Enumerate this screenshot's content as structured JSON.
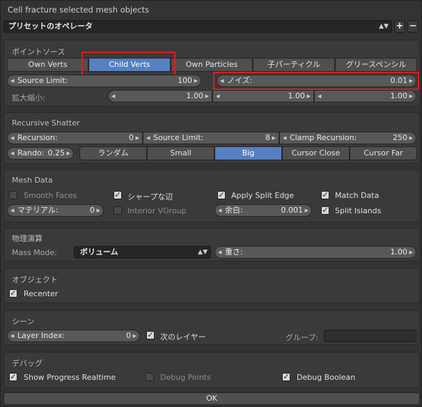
{
  "window": {
    "title": "Cell fracture selected mesh objects"
  },
  "preset": {
    "label": "プリセットのオペレータ",
    "add": "+",
    "remove": "−"
  },
  "point_source": {
    "title": "ポイントソース",
    "modes": [
      "Own Verts",
      "Child Verts",
      "Own Particles",
      "子パーティクル",
      "グリースペンシル"
    ],
    "selected": "Child Verts",
    "source_limit": {
      "label": "Source Limit:",
      "value": "100"
    },
    "noise": {
      "label": "ノイズ:",
      "value": "0.01"
    },
    "scale": {
      "label": "拡大縮小:",
      "x": "1.00",
      "y": "1.00",
      "z": "1.00"
    }
  },
  "recursive": {
    "title": "Recursive Shatter",
    "recursion": {
      "label": "Recursion:",
      "value": "0"
    },
    "source_limit": {
      "label": "Source Limit:",
      "value": "8"
    },
    "clamp": {
      "label": "Clamp Recursion:",
      "value": "250"
    },
    "rando": {
      "label": "Rando:",
      "value": "0.25"
    },
    "modes": [
      "ランダム",
      "Small",
      "Big",
      "Cursor Close",
      "Cursor Far"
    ],
    "selected": "Big"
  },
  "mesh": {
    "title": "Mesh Data",
    "smooth_faces": "Smooth Faces",
    "sharp_edges": "シャープな辺",
    "apply_split_edge": "Apply Split Edge",
    "match_data": "Match Data",
    "material": {
      "label": "マテリアル:",
      "value": "0"
    },
    "interior_vgroup": "Interior VGroup",
    "margin": {
      "label": "余白:",
      "value": "0.001"
    },
    "split_islands": "Split Islands"
  },
  "physics": {
    "title": "物理演算",
    "mass_mode_label": "Mass Mode:",
    "mass_mode_value": "ボリューム",
    "mass": {
      "label": "重さ:",
      "value": "1.00"
    }
  },
  "object": {
    "title": "オブジェクト",
    "recenter": "Recenter"
  },
  "scene": {
    "title": "シーン",
    "layer_index": {
      "label": "Layer Index:",
      "value": "0"
    },
    "next_layer": "次のレイヤー",
    "group_label": "グループ:"
  },
  "debug": {
    "title": "デバッグ",
    "progress": "Show Progress Realtime",
    "points": "Debug Points",
    "boolean": "Debug Boolean"
  },
  "ok": "OK"
}
